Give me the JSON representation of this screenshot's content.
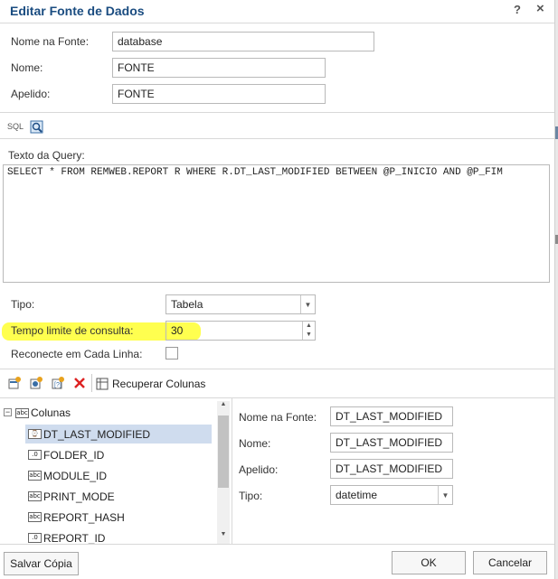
{
  "dialog": {
    "title": "Editar Fonte de Dados",
    "help": "?",
    "close": "×"
  },
  "source": {
    "nome_fonte_label": "Nome na Fonte:",
    "nome_fonte_value": "database",
    "nome_label": "Nome:",
    "nome_value": "FONTE",
    "apelido_label": "Apelido:",
    "apelido_value": "FONTE"
  },
  "sql_toolbar": {
    "sql_label": "SQL"
  },
  "query": {
    "label": "Texto da Query:",
    "text": "SELECT * FROM REMWEB.REPORT R WHERE R.DT_LAST_MODIFIED BETWEEN @P_INICIO AND @P_FIM"
  },
  "options": {
    "tipo_label": "Tipo:",
    "tipo_value": "Tabela",
    "tempo_label": "Tempo limite de consulta:",
    "tempo_value": "30",
    "reconecte_label": "Reconecte em Cada Linha:"
  },
  "columns_toolbar": {
    "recuperar_label": "Recuperar Colunas"
  },
  "tree": {
    "root_label": "Colunas",
    "items": [
      {
        "name": "DT_LAST_MODIFIED",
        "icon": "⌚"
      },
      {
        "name": "FOLDER_ID",
        "icon": ".0"
      },
      {
        "name": "MODULE_ID",
        "icon": "abc"
      },
      {
        "name": "PRINT_MODE",
        "icon": "abc"
      },
      {
        "name": "REPORT_HASH",
        "icon": "abc"
      },
      {
        "name": "REPORT_ID",
        "icon": ".0"
      }
    ]
  },
  "details": {
    "nome_fonte_label": "Nome na Fonte:",
    "nome_fonte_value": "DT_LAST_MODIFIED",
    "nome_label": "Nome:",
    "nome_value": "DT_LAST_MODIFIED",
    "apelido_label": "Apelido:",
    "apelido_value": "DT_LAST_MODIFIED",
    "tipo_label": "Tipo:",
    "tipo_value": "datetime"
  },
  "footer": {
    "salvar_copia": "Salvar Cópia",
    "ok": "OK",
    "cancelar": "Cancelar"
  },
  "colors": {
    "title": "#1a4c80",
    "highlight": "#ffff30",
    "selected_row": "#cfdcee"
  }
}
